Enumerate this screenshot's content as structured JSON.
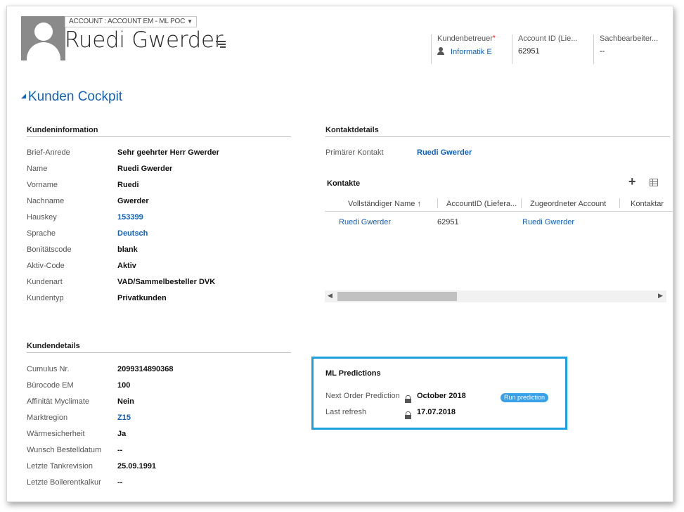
{
  "header": {
    "form_selector": "ACCOUNT : ACCOUNT EM - ML POC",
    "record_title": "Ruedi Gwerder",
    "fields": [
      {
        "label": "Kundenbetreuer",
        "required": "*",
        "value": "Informatik E"
      },
      {
        "label": "Account ID (Lie...",
        "value": "62951"
      },
      {
        "label": "Sachbearbeiter...",
        "value": "--"
      }
    ]
  },
  "section": {
    "title": "Kunden Cockpit",
    "toggle_glyph": "◢"
  },
  "kundeninformation": {
    "header": "Kundeninformation",
    "rows": [
      {
        "label": "Brief-Anrede",
        "value": "Sehr geehrter Herr Gwerder"
      },
      {
        "label": "Name",
        "value": "Ruedi Gwerder"
      },
      {
        "label": "Vorname",
        "value": "Ruedi"
      },
      {
        "label": "Nachname",
        "value": "Gwerder"
      },
      {
        "label": "Hauskey",
        "value": "153399"
      },
      {
        "label": "Sprache",
        "value": "Deutsch"
      },
      {
        "label": "Bonitätscode",
        "value": "blank"
      },
      {
        "label": "Aktiv-Code",
        "value": "Aktiv"
      },
      {
        "label": "Kundenart",
        "value": "VAD/Sammelbesteller DVK"
      },
      {
        "label": "Kundentyp",
        "value": "Privatkunden"
      }
    ]
  },
  "kundendetails": {
    "header": "Kundendetails",
    "rows": [
      {
        "label": "Cumulus Nr.",
        "value": "2099314890368"
      },
      {
        "label": "Bürocode EM",
        "value": "100"
      },
      {
        "label": "Affinität Myclimate",
        "value": "Nein"
      },
      {
        "label": "Marktregion",
        "value": "Z15"
      },
      {
        "label": "Wärmesicherheit",
        "value": "Ja"
      },
      {
        "label": "Wunsch Bestelldatum",
        "value": "--"
      },
      {
        "label": "Letzte Tankrevision",
        "value": "25.09.1991"
      },
      {
        "label": "Letzte Boilerentkalkur",
        "value": "--"
      }
    ]
  },
  "kontaktdetails": {
    "header": "Kontaktdetails",
    "primary_label": "Primärer Kontakt",
    "primary_value": "Ruedi Gwerder"
  },
  "kontakte": {
    "title": "Kontakte",
    "add_glyph": "+",
    "columns": [
      "Vollständiger Name ↑",
      "AccountID (Liefera...",
      "Zugeordneter Account",
      "Kontaktar"
    ],
    "rows": [
      {
        "name": "Ruedi Gwerder",
        "account_id": "62951",
        "account": "Ruedi Gwerder",
        "kontaktart": ""
      }
    ],
    "scroll_left": "◀",
    "scroll_right": "▶"
  },
  "ml_predictions": {
    "header": "ML Predictions",
    "next_label": "Next Order Prediction",
    "next_value": "October 2018",
    "refresh_label": "Last refresh",
    "refresh_value": "17.07.2018",
    "run_button": "Run prediction"
  },
  "colors": {
    "accent": "#1160b7",
    "highlight_border": "#1ba1e2",
    "button": "#3aa0e8"
  }
}
